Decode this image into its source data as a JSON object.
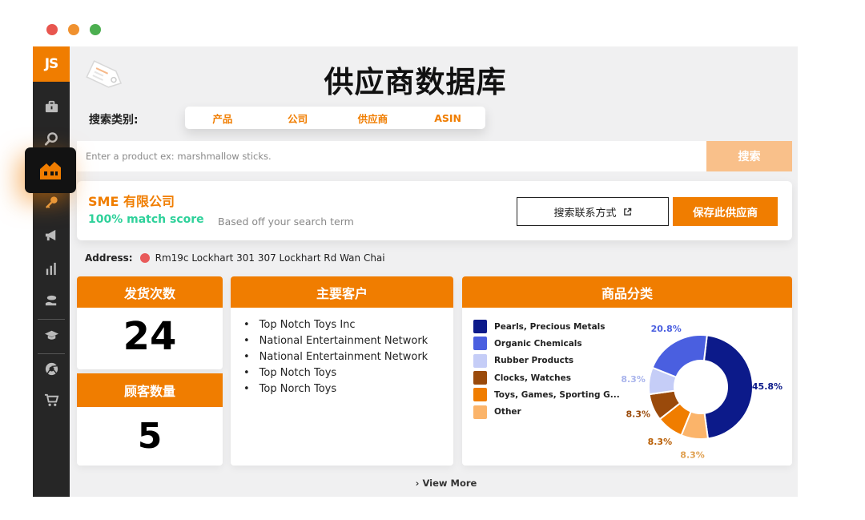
{
  "colors": {
    "accent": "#f07d00",
    "sidebar": "#262626",
    "match": "#2ed19a"
  },
  "window_dots": [
    "#e8564f",
    "#f0912f",
    "#4caf50"
  ],
  "sidebar": {
    "logo": "JS",
    "icons": [
      "briefcase-icon",
      "search-icon",
      "supplier-icon",
      "key-icon",
      "megaphone-icon",
      "bar-chart-icon",
      "hand-coin-icon",
      "graduation-cap-icon",
      "chrome-icon",
      "cart-icon"
    ]
  },
  "header": {
    "title": "供应商数据库"
  },
  "search_category": {
    "label": "搜索类别:",
    "tabs": [
      "产品",
      "公司",
      "供应商",
      "ASIN"
    ]
  },
  "search": {
    "placeholder": "Enter a product ex: marshmallow sticks.",
    "button": "搜索"
  },
  "supplier": {
    "name": "SME 有限公司",
    "match_score": "100% match score",
    "match_note": "Based off your search term",
    "contact_button": "搜索联系方式",
    "save_button": "保存此供应商"
  },
  "address": {
    "label": "Address:",
    "value": "Rm19c Lockhart 301 307 Lockhart Rd Wan Chai"
  },
  "shipments": {
    "title": "发货次数",
    "value": "24"
  },
  "customers_count": {
    "title": "顾客数量",
    "value": "5"
  },
  "main_customers": {
    "title": "主要客户",
    "items": [
      "Top Notch Toys Inc",
      "National Entertainment Network",
      "National Entertainment Network",
      "Top Notch Toys",
      "Top Norch Toys"
    ]
  },
  "categories": {
    "title": "商品分类"
  },
  "chart_data": {
    "type": "pie",
    "donut": true,
    "categories": [
      "Pearls, Precious Metals",
      "Organic Chemicals",
      "Rubber Products",
      "Clocks, Watches",
      "Toys, Games, Sporting Goods",
      "Other"
    ],
    "legend_labels": [
      "Pearls, Precious Metals",
      "Organic Chemicals",
      "Rubber Products",
      "Clocks, Watches",
      "Toys, Games, Sporting G...",
      "Other"
    ],
    "values": [
      45.8,
      20.8,
      8.3,
      8.3,
      8.3,
      8.3
    ],
    "value_labels": [
      "45.8%",
      "20.8%",
      "8.3%",
      "8.3%",
      "8.3%",
      "8.3%"
    ],
    "colors": [
      "#0c1a8a",
      "#4a5fe0",
      "#c5cdf7",
      "#9a4a0b",
      "#f07d00",
      "#fbb46a"
    ],
    "legend_position": "left"
  },
  "footer": {
    "view_more": "View More"
  }
}
